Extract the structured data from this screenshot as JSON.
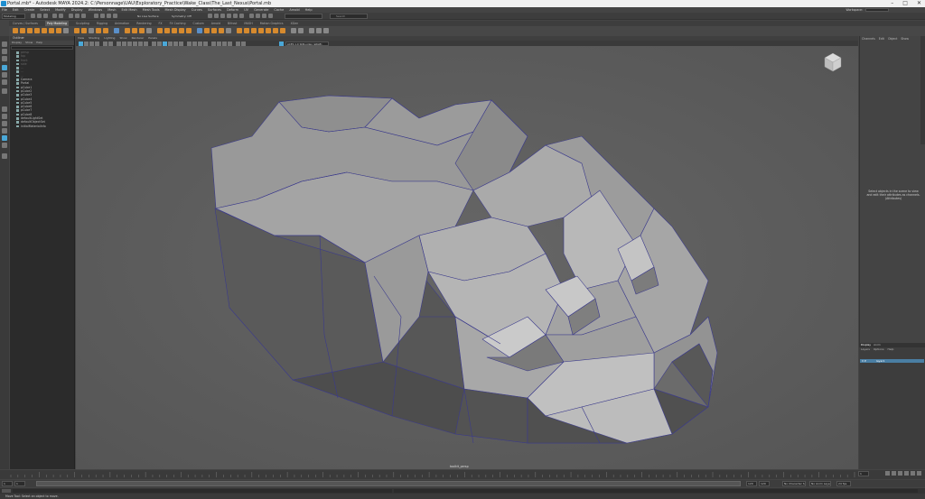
{
  "window": {
    "title": "Portal.mb* - Autodesk MAYA 2024.2: C:\\Personnage\\UAU\\Exploratory_Practice\\Wake_Class\\The_Last_Nexus\\Portal.mb",
    "controls": [
      "–",
      "□",
      "✕"
    ]
  },
  "menubar": {
    "items": [
      "File",
      "Edit",
      "Create",
      "Select",
      "Modify",
      "Display",
      "Windows",
      "Mesh",
      "Edit Mesh",
      "Mesh Tools",
      "Mesh Display",
      "Curves",
      "Surfaces",
      "Deform",
      "UV",
      "Generate",
      "Cache",
      "Arnold",
      "Help"
    ],
    "workspace_label": "Workspace:"
  },
  "statusline": {
    "mode": "Modeling",
    "symmetry": "Symmetry: Off",
    "no_live": "No Live Surface",
    "search_placeholder": "Search"
  },
  "shelf": {
    "tabs": [
      "Curves / Surfaces",
      "Poly Modeling",
      "Sculpting",
      "Rigging",
      "Animation",
      "Rendering",
      "FX",
      "FX Caching",
      "Custom",
      "Arnold",
      "Bifrost",
      "MASH",
      "Motion Graphics",
      "XGen"
    ],
    "active_tab": "Poly Modeling"
  },
  "outliner": {
    "title": "Outliner",
    "menu": [
      "Display",
      "Show",
      "Help"
    ],
    "items": [
      {
        "label": "persp",
        "dim": true
      },
      {
        "label": "top",
        "dim": true
      },
      {
        "label": "front",
        "dim": true
      },
      {
        "label": "side",
        "dim": true
      },
      {
        "label": "...",
        "dim": true
      },
      {
        "label": "...",
        "dim": true
      },
      {
        "label": "...",
        "dim": true
      },
      {
        "label": "Camera",
        "dim": false
      },
      {
        "label": "Portal",
        "dim": false
      },
      {
        "label": "pCube1",
        "dim": false
      },
      {
        "label": "pCube2",
        "dim": false
      },
      {
        "label": "pCube3",
        "dim": false
      },
      {
        "label": "pCube4",
        "dim": false
      },
      {
        "label": "pCube5",
        "dim": false
      },
      {
        "label": "pCube6",
        "dim": false
      },
      {
        "label": "pCube7",
        "dim": false
      },
      {
        "label": "pCube8",
        "dim": false
      },
      {
        "label": "defaultLightSet",
        "dim": false
      },
      {
        "label": "defaultObjectSet",
        "dim": false
      },
      {
        "label": "initialMaterialInfo",
        "dim": false
      }
    ]
  },
  "viewport": {
    "menu": [
      "View",
      "Shading",
      "Lighting",
      "Show",
      "Renderer",
      "Panels"
    ],
    "camera_label": "toolkit_persp",
    "colorspace": "ACES 1.0 SDR-video (sRGB)"
  },
  "channelbox": {
    "tabs": [
      "Channels",
      "Edit",
      "Object",
      "Show"
    ],
    "empty_message": "Select objects in the scene to view and edit their attributes as channels. (Attributes)"
  },
  "layers": {
    "tabs": [
      "Display",
      "Anim"
    ],
    "menu": [
      "Layers",
      "Options",
      "Help"
    ],
    "layer_name": "layer1",
    "layer_flags": "V P"
  },
  "timeline": {
    "current_frame": "1",
    "start": "1",
    "end": "120",
    "range_start": "1",
    "range_end": "120",
    "fps": "24 fps",
    "character_set": "No Character Set",
    "anim_layer": "No Anim Layer"
  },
  "helpline": {
    "text": "Move Tool: Select an object to move."
  },
  "colors": {
    "viewport_bg": "#5e5e5e",
    "wire": "#3b3a8c",
    "accent": "#4aa8d8",
    "shelf_orange": "#d68a2e"
  }
}
